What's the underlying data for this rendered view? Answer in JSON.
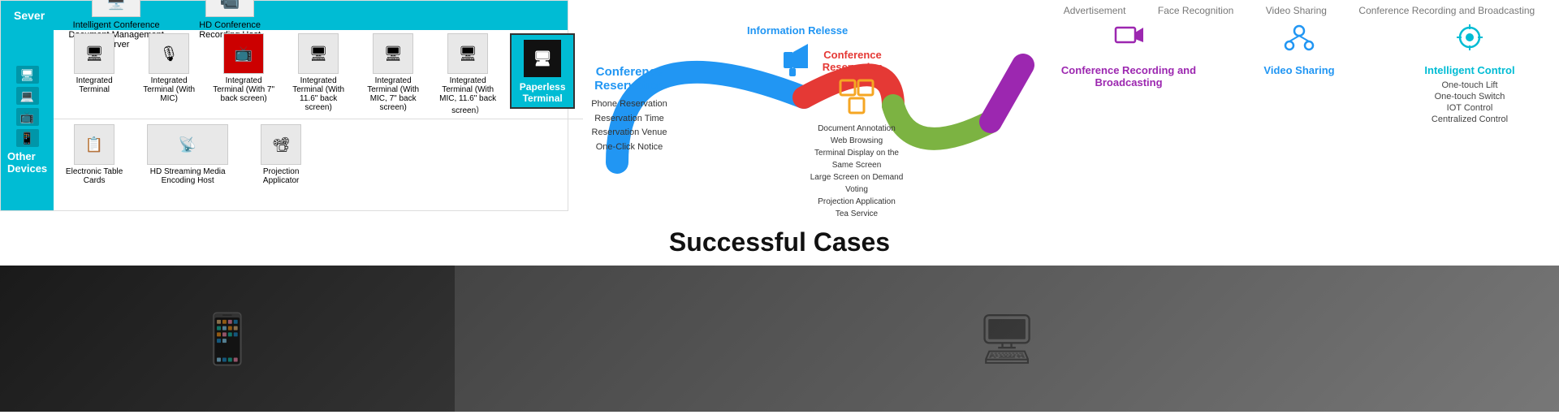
{
  "left": {
    "server_label": "Sever",
    "server_items": [
      {
        "label": "Intelligent Conference Document Management Server"
      },
      {
        "label": "HD Conference Recording Host"
      }
    ],
    "other_devices_label": "Other Devices",
    "devices": [
      {
        "label": "Integrated Terminal"
      },
      {
        "label": "Integrated Terminal (With MIC)"
      },
      {
        "label": "Integrated Terminal (With 7\" back screen)"
      },
      {
        "label": "Integrated Terminal (With 11.6\" back screen)"
      },
      {
        "label": "Integrated Terminal (With MIC, 7\" back screen)"
      },
      {
        "label": "Integrated Terminal (With MIC, 11.6\" back screen）"
      }
    ],
    "paperless_terminal_label": "Paperless Terminal",
    "bottom_devices": [
      {
        "label": "Electronic Table Cards"
      },
      {
        "label": "HD Streaming Media Encoding Host"
      },
      {
        "label": "Projection Applicator"
      }
    ]
  },
  "middle": {
    "conf_reservation": "Conference Reservation",
    "info_release": "Information Relesse",
    "conf_reservation2": "Conference Reservation",
    "phone_reservation": "Phone Reservation",
    "reservation_time": "Reservation Time",
    "reservation_venue": "Reservation Venue",
    "one_click_notice": "One-Click Notice",
    "doc_annotation": "Document Annotation",
    "web_browsing": "Web Browsing",
    "terminal_display": "Terminal Display on the Same Screen",
    "large_screen": "Large Screen on Demand",
    "voting": "Voting",
    "projection": "Projection Application",
    "tea_service": "Tea Service"
  },
  "right": {
    "top_labels": [
      "Advertisement",
      "Face Recognition",
      "Video Sharing",
      "Conference Recording and Broadcasting"
    ],
    "conference_rec_broadcast": "Conference Recording and Broadcasting",
    "video_sharing": "Video Sharing",
    "intelligent_control": "Intelligent Control",
    "one_touch_lift": "One-touch Lift",
    "one_touch_switch": "One-touch Switch",
    "iot_control": "IOT Control",
    "centralized_control": "Centralized Control"
  },
  "successful_cases": {
    "title": "Successful Cases"
  }
}
